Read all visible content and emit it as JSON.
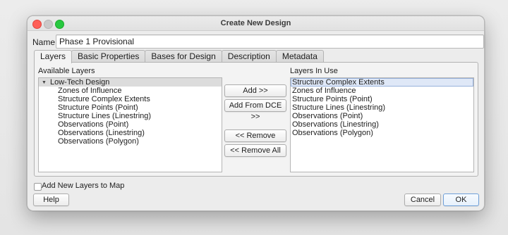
{
  "window": {
    "title": "Create New Design"
  },
  "name_field": {
    "label": "Name",
    "value": "Phase 1 Provisional"
  },
  "tabs": [
    {
      "label": "Layers",
      "active": true
    },
    {
      "label": "Basic Properties",
      "active": false
    },
    {
      "label": "Bases for Design",
      "active": false
    },
    {
      "label": "Description",
      "active": false
    },
    {
      "label": "Metadata",
      "active": false
    }
  ],
  "available_layers": {
    "label": "Available Layers",
    "group": "Low-Tech Design",
    "items": [
      "Zones of Influence",
      "Structure Complex Extents",
      "Structure Points (Point)",
      "Structure Lines (Linestring)",
      "Observations (Point)",
      "Observations (Linestring)",
      "Observations (Polygon)"
    ]
  },
  "layers_in_use": {
    "label": "Layers In Use",
    "selected_index": 0,
    "items": [
      "Structure Complex Extents",
      "Zones of Influence",
      "Structure Points (Point)",
      "Structure Lines (Linestring)",
      "Observations (Point)",
      "Observations (Linestring)",
      "Observations (Polygon)"
    ]
  },
  "transfer_buttons": {
    "add": "Add >>",
    "add_from_dce": "Add From DCE >>",
    "remove": "<< Remove",
    "remove_all": "<< Remove All"
  },
  "add_to_map": {
    "label": "Add New Layers to Map",
    "checked": false
  },
  "footer": {
    "help": "Help",
    "cancel": "Cancel",
    "ok": "OK"
  },
  "icons": {
    "close": "close-icon",
    "minimize": "minimize-icon",
    "maximize": "maximize-icon",
    "tree_expander": "caret-down-icon"
  }
}
